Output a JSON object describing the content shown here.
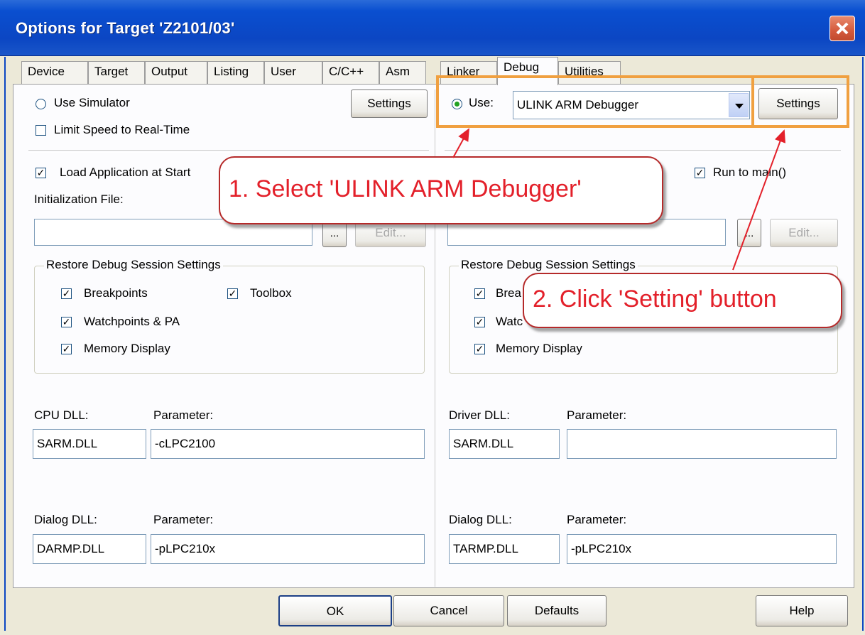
{
  "window": {
    "title": "Options for Target 'Z2101/03'"
  },
  "tabs": [
    {
      "label": "Device"
    },
    {
      "label": "Target"
    },
    {
      "label": "Output"
    },
    {
      "label": "Listing"
    },
    {
      "label": "User"
    },
    {
      "label": "C/C++"
    },
    {
      "label": "Asm"
    },
    {
      "label": "Linker"
    },
    {
      "label": "Debug"
    },
    {
      "label": "Utilities"
    }
  ],
  "active_tab": "Debug",
  "left": {
    "use_simulator": "Use Simulator",
    "settings": "Settings",
    "limit_speed": "Limit Speed to Real-Time",
    "load_app": "Load Application at Start",
    "init_file_label": "Initialization File:",
    "browse": "...",
    "edit": "Edit...",
    "restore_group": "Restore Debug Session Settings",
    "breakpoints": "Breakpoints",
    "toolbox": "Toolbox",
    "watchpoints": "Watchpoints & PA",
    "memory_display": "Memory Display",
    "cpu_dll_label": "CPU DLL:",
    "cpu_dll": "SARM.DLL",
    "cpu_param_label": "Parameter:",
    "cpu_param": "-cLPC2100",
    "dialog_dll_label": "Dialog DLL:",
    "dialog_dll": "DARMP.DLL",
    "dialog_param_label": "Parameter:",
    "dialog_param": "-pLPC210x"
  },
  "right": {
    "use": "Use:",
    "debugger": "ULINK ARM Debugger",
    "settings": "Settings",
    "run_to_main": "Run to main()",
    "browse": "...",
    "edit": "Edit...",
    "restore_group": "Restore Debug Session Settings",
    "breakpoints_partial": "Brea",
    "watchpoints_partial": "Watc",
    "memory_display": "Memory Display",
    "driver_dll_label": "Driver DLL:",
    "driver_dll": "SARM.DLL",
    "driver_param_label": "Parameter:",
    "driver_param": "",
    "dialog_dll_label": "Dialog DLL:",
    "dialog_dll": "TARMP.DLL",
    "dialog_param_label": "Parameter:",
    "dialog_param": "-pLPC210x"
  },
  "footer": {
    "ok": "OK",
    "cancel": "Cancel",
    "defaults": "Defaults",
    "help": "Help"
  },
  "annotations": {
    "callout1": "1. Select 'ULINK ARM Debugger'",
    "callout2": "2. Click 'Setting' button"
  },
  "colors": {
    "titlebar": "#0b46c3",
    "highlight": "#f0a040",
    "callout_text": "#e3202a",
    "arrow": "#e3202a"
  },
  "icons": {
    "close": "close-icon",
    "check": "check-icon",
    "dropdown": "chevron-down-icon"
  }
}
